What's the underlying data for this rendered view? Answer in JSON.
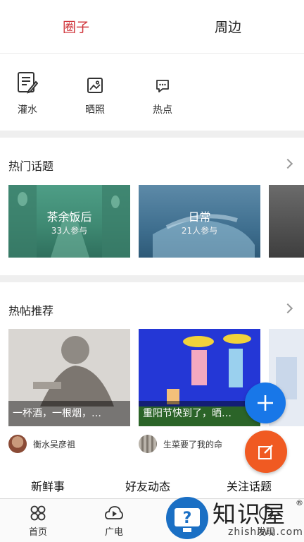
{
  "top_tabs": {
    "circle": "圈子",
    "nearby": "周边"
  },
  "quick_actions": [
    {
      "label": "灌水",
      "icon": "note-edit-icon"
    },
    {
      "label": "晒照",
      "icon": "photo-icon"
    },
    {
      "label": "热点",
      "icon": "chat-bubble-icon"
    }
  ],
  "hot_topics": {
    "title": "热门话题",
    "items": [
      {
        "name": "茶余饭后",
        "count": "33人参与"
      },
      {
        "name": "日常",
        "count": "21人参与"
      }
    ]
  },
  "hot_posts": {
    "title": "热帖推荐",
    "items": [
      {
        "caption": "一杯酒，一根烟，…",
        "author": "衡水吴彦祖"
      },
      {
        "caption": "重阳节快到了，晒…",
        "author": "生菜要了我的命"
      }
    ]
  },
  "feed_tabs": [
    "新鲜事",
    "好友动态",
    "关注话题"
  ],
  "bottom_nav": [
    {
      "label": "首页",
      "icon": "home-grid-icon"
    },
    {
      "label": "广电",
      "icon": "broadcast-play-icon"
    },
    {
      "label": "发现",
      "icon": "discover-icon"
    }
  ],
  "watermark": {
    "brand": "知识屋",
    "url": "zhishiwu.com",
    "reg": "®"
  },
  "colors": {
    "accent": "#d0343a",
    "fab": "#1877e8",
    "fab_edit": "#f05a22"
  }
}
